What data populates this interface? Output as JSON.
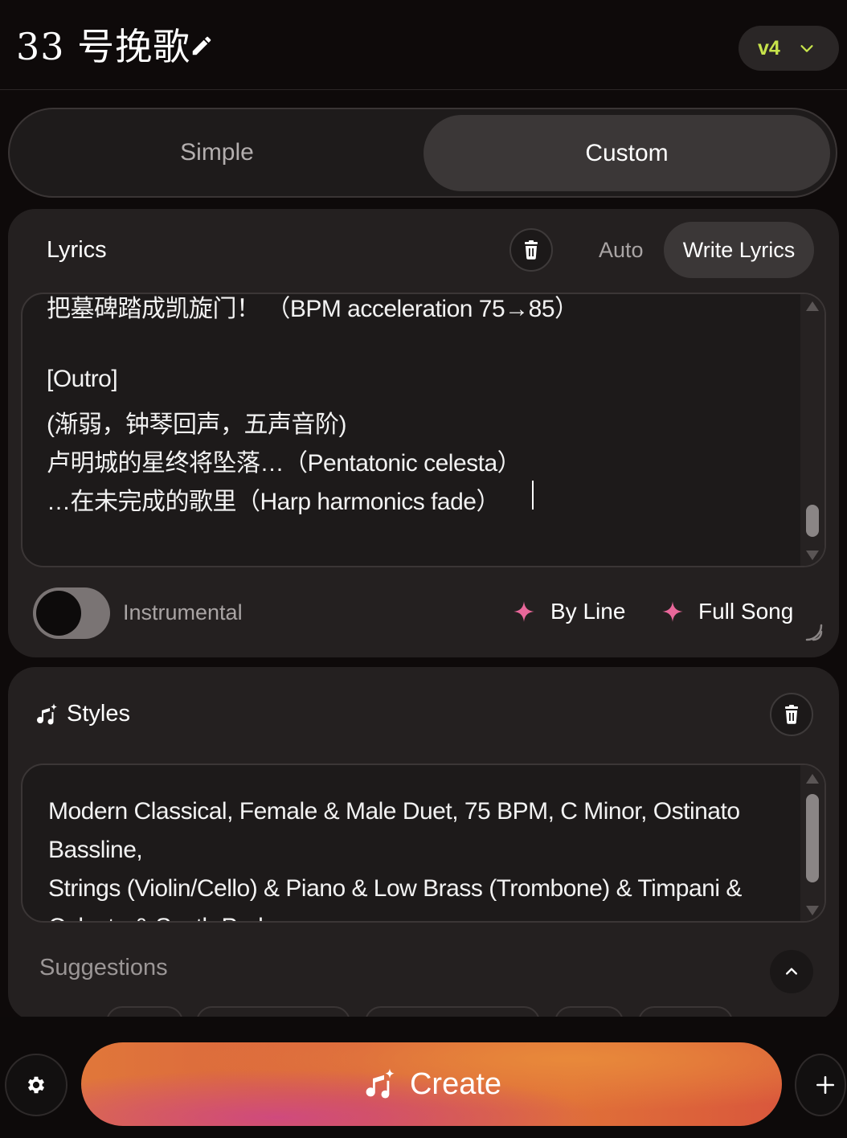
{
  "header": {
    "title": "33 号挽歌",
    "version": "v4"
  },
  "mode_tabs": {
    "simple": "Simple",
    "custom": "Custom",
    "active": "Custom"
  },
  "lyrics": {
    "title": "Lyrics",
    "mode_auto": "Auto",
    "mode_write": "Write Lyrics",
    "lines": [
      "把墓碑踏成凯旋门！ （BPM acceleration 75→85）",
      "",
      "[Outro]",
      "(渐弱，钟琴回声，五声音阶)",
      "卢明城的星终将坠落…（Pentatonic celesta）",
      "…在未完成的歌里（Harp harmonics fade）"
    ],
    "instrumental_label": "Instrumental",
    "instrumental_on": false,
    "by_line": "By Line",
    "full_song": "Full Song"
  },
  "styles": {
    "title": "Styles",
    "text_lines": [
      "Modern Classical, Female & Male Duet, 75 BPM, C Minor, Ostinato",
      "Bassline,",
      "Strings (Violin/Cello) & Piano & Low Brass (Trombone) & Timpani &",
      "Celesta & Synth Pad"
    ],
    "suggestions_label": "Suggestions"
  },
  "actions": {
    "create": "Create"
  },
  "colors": {
    "accent_version": "#c7e34b",
    "sparkle": "#e9679a",
    "create_start": "#e0773a",
    "create_mid": "#cf4a7d"
  }
}
